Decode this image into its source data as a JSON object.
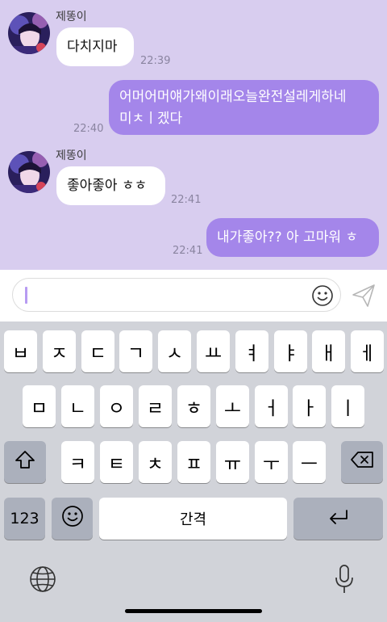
{
  "chat": {
    "messages": [
      {
        "id": "m1",
        "type": "received",
        "sender": "제똥이",
        "text": "다치지마",
        "time": "22:39"
      },
      {
        "id": "m2",
        "type": "sent",
        "line1": "어머어머얘가왜이래오늘완전설레게하네",
        "line2": "미ㅊㅣ겠다",
        "time": "22:40"
      },
      {
        "id": "m3",
        "type": "received",
        "sender": "제똥이",
        "text": "좋아좋아 ㅎㅎ",
        "time": "22:41"
      },
      {
        "id": "m4",
        "type": "sent",
        "text": "내가좋아?? 아 고마워 ㅎ",
        "time": "22:41"
      }
    ]
  },
  "input": {
    "value": "",
    "placeholder": ""
  },
  "keyboard": {
    "row1": [
      "ㅂ",
      "ㅈ",
      "ㄷ",
      "ㄱ",
      "ㅅ",
      "ㅛ",
      "ㅕ",
      "ㅑ",
      "ㅐ",
      "ㅔ"
    ],
    "row2": [
      "ㅁ",
      "ㄴ",
      "ㅇ",
      "ㄹ",
      "ㅎ",
      "ㅗ",
      "ㅓ",
      "ㅏ",
      "ㅣ"
    ],
    "row3": [
      "ㅋ",
      "ㅌ",
      "ㅊ",
      "ㅍ",
      "ㅠ",
      "ㅜ",
      "ㅡ"
    ],
    "numbers_label": "123",
    "space_label": "간격"
  },
  "icons": {
    "emoji": "emoji-icon",
    "send": "send-icon",
    "shift": "shift-icon",
    "backspace": "backspace-icon",
    "emoji_key": "emoji-key-icon",
    "return": "return-icon",
    "globe": "globe-icon",
    "mic": "mic-icon"
  },
  "colors": {
    "chat_background": "#d8cdef",
    "sent_bubble": "#a486ea",
    "received_bubble": "#ffffff",
    "caret": "#b79bf2",
    "keyboard_background": "#d1d3d9",
    "special_key": "#abb0bc"
  }
}
